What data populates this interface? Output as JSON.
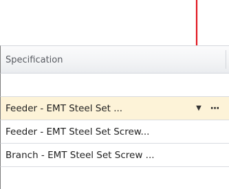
{
  "column": {
    "header": "Specification"
  },
  "rows": [
    {
      "value": "Feeder - EMT Steel Set ...",
      "selected": true
    },
    {
      "value": "Feeder - EMT Steel Set Screw..."
    },
    {
      "value": "Branch - EMT Steel Set Screw ..."
    }
  ],
  "cell_buttons": {
    "dropdown_icon": "▼",
    "browse_label": "···"
  },
  "colors": {
    "annotation_arrow": "#e0141e",
    "selected_row": "#fdf3d8"
  }
}
